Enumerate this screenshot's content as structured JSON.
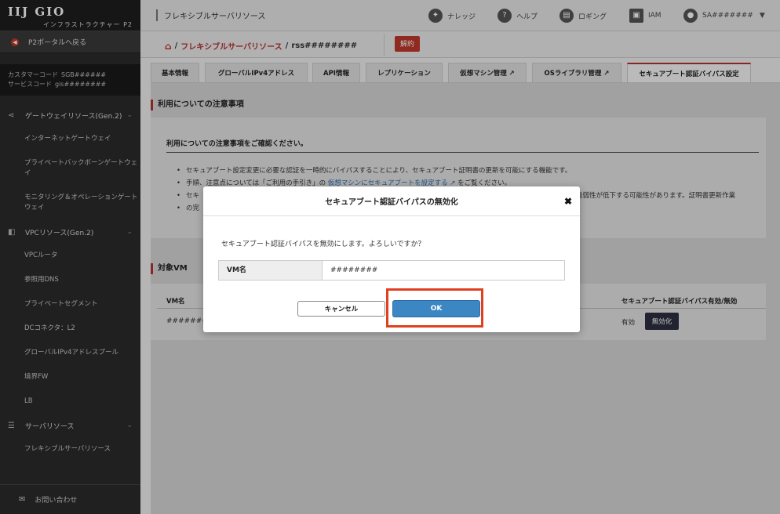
{
  "brand": {
    "logo": "IIJ GIO",
    "sub": "インフラストラクチャー P2"
  },
  "sidebar": {
    "portal_back": "P2ポータルへ戻る",
    "customer_code_label": "カスタマーコード",
    "customer_code": "SGB######",
    "service_code_label": "サービスコード",
    "service_code": "gis########",
    "sections": [
      {
        "label": "ゲートウェイリソース(Gen.2)",
        "items": [
          "インターネットゲートウェイ",
          "プライベートバックボーンゲートウェイ",
          "モニタリング＆オペレーションゲートウェイ"
        ]
      },
      {
        "label": "VPCリソース(Gen.2)",
        "items": [
          "VPCルータ",
          "参照用DNS",
          "プライベートセグメント",
          "DCコネクタ：L2",
          "グローバルIPv4アドレスプール",
          "境界FW",
          "LB"
        ]
      },
      {
        "label": "サーバリソース",
        "items": [
          "フレキシブルサーバリソース"
        ]
      }
    ],
    "contact": "お問い合わせ"
  },
  "topbar": {
    "title": "フレキシブルサーバリソース",
    "knowledge": "ナレッジ",
    "help": "ヘルプ",
    "logging": "ロギング",
    "iam": "IAM",
    "user": "SA#######"
  },
  "breadcrumb": {
    "parent": "フレキシブルサーバリソース",
    "current": "rss########",
    "sep": "/",
    "cancel_button": "解約"
  },
  "tabs": [
    "基本情報",
    "グローバルIPv4アドレス",
    "API情報",
    "レプリケーション",
    "仮想マシン管理 ↗",
    "OSライブラリ管理 ↗",
    "セキュアブート認証バイパス設定"
  ],
  "notice": {
    "title": "利用についての注意事項",
    "heading": "利用についての注意事項をご確認ください。",
    "bullet1": "セキュアブート設定変更に必要な認証を一時的にバイパスすることにより、セキュアブート証明書の更新を可能にする機能です。",
    "bullet2_pre": "手順、注意点については「ご利用の手引き」の",
    "bullet2_link": "仮想マシンにセキュアブートを設定する ↗",
    "bullet2_post": "をご覧ください。",
    "bullet3_pre": "セキ",
    "bullet3_post": "脆弱性が低下する可能性があります。証明書更新作業",
    "bullet3_line2": "の完"
  },
  "target": {
    "title": "対象VM",
    "col_vm": "VM名",
    "col_status": "セキュアブート認証バイパス有効/無効",
    "row_vm": "#######",
    "row_status": "有効",
    "row_button": "無効化"
  },
  "modal": {
    "title": "セキュアブート認証バイパスの無効化",
    "close": "✖",
    "message": "セキュアブート認証バイパスを無効にします。よろしいですか？",
    "vm_label": "VM名",
    "vm_value": "########",
    "cancel": "キャンセル",
    "ok": "OK"
  },
  "colors": {
    "accent": "#b83232",
    "ok_button": "#3c86c4",
    "highlight": "#e0401f"
  }
}
